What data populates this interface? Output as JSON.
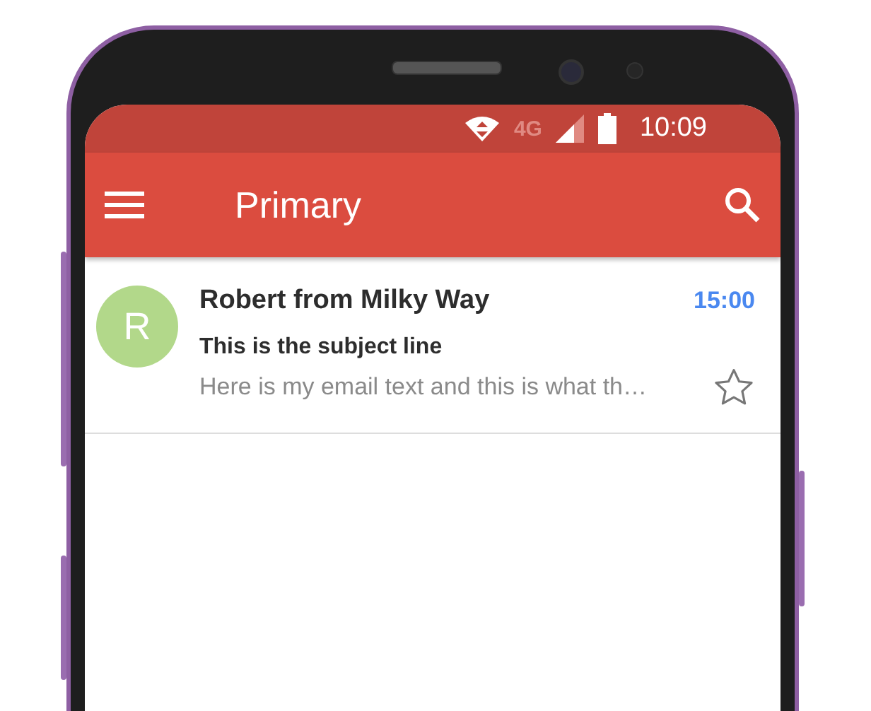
{
  "status_bar": {
    "network": "4G",
    "time": "10:09"
  },
  "app_bar": {
    "title": "Primary"
  },
  "emails": [
    {
      "avatar": "R",
      "color": "#b2d88a",
      "sender": "Robert from Milky Way",
      "time": "15:00",
      "subject": "This is the subject line",
      "preview": "Here is my email text and this is what th…",
      "starred": false
    }
  ]
}
